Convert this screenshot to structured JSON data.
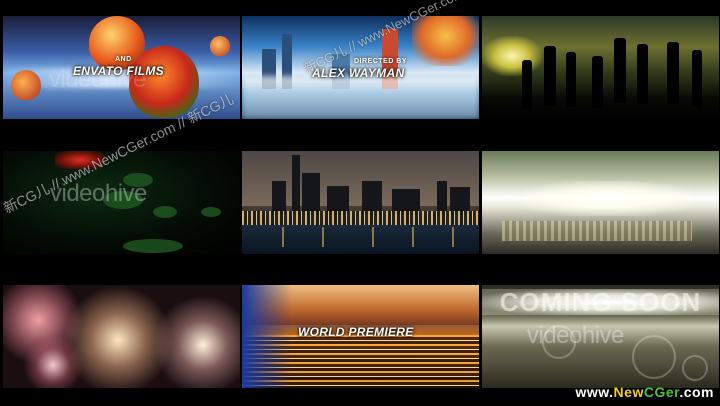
{
  "frames": [
    {
      "id": 1,
      "caption_small": "AND",
      "caption_big": "ENVATO FILMS"
    },
    {
      "id": 2,
      "caption_small": "DIRECTED BY",
      "caption_big": "ALEX WAYMAN"
    },
    {
      "id": 3
    },
    {
      "id": 4
    },
    {
      "id": 5
    },
    {
      "id": 6
    },
    {
      "id": 7
    },
    {
      "id": 8,
      "caption_big": "WORLD PREMIERE"
    },
    {
      "id": 9,
      "caption_big": "COMING SOON"
    }
  ],
  "watermarks": {
    "diagonal_1": "新CG儿 // www.NewCGer.com // 新CG儿",
    "diagonal_2": "新CG儿 // www.NewCGer.com // 新CG儿",
    "videohive": "videohive"
  },
  "brand": {
    "prefix": "www.",
    "new": "New",
    "cger": "CGer",
    "suffix": ".com"
  },
  "colors": {
    "background": "#000000",
    "brand_white": "#ffffff",
    "brand_yellow": "#f0d020",
    "brand_green": "#50c040"
  }
}
